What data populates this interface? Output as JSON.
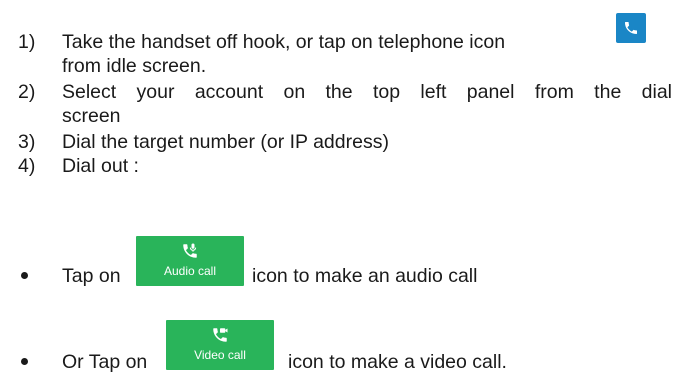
{
  "steps": [
    {
      "number": "1)",
      "line1": "Take the handset off hook, or tap on telephone icon",
      "line2": "from idle screen."
    },
    {
      "number": "2)",
      "line1": "Select your account on the top left panel from the dial",
      "line2": "screen"
    },
    {
      "number": "3)",
      "line1": "Dial the target number (or IP address)"
    },
    {
      "number": "4)",
      "line1": "Dial out :"
    }
  ],
  "bullets": [
    {
      "before": "Tap on",
      "button_label": "Audio call",
      "after": "icon to make an audio call"
    },
    {
      "before": "Or Tap on",
      "button_label": "Video call",
      "after": "icon to make a video call."
    }
  ],
  "icons": {
    "telephone": "telephone-icon",
    "audio_call": "audio-call-icon",
    "video_call": "video-call-icon"
  },
  "colors": {
    "telephone_icon_bg": "#1a86c6",
    "call_button_bg": "#29b45a"
  }
}
